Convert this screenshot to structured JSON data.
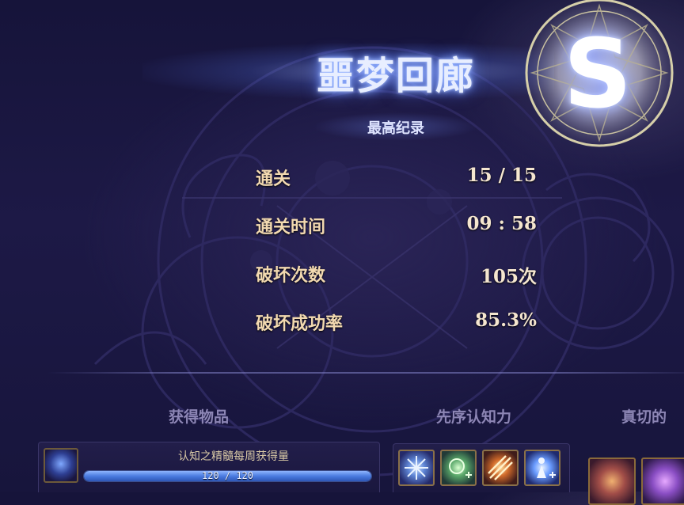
{
  "dungeon": {
    "title": "噩梦回廊",
    "rank": "S",
    "record_label": "最高纪录"
  },
  "stats": [
    {
      "label": "通关",
      "value": "15 / 15"
    },
    {
      "label": "通关时间",
      "value": "09 : 58"
    },
    {
      "label": "破坏次数",
      "value": "105次"
    },
    {
      "label": "破坏成功率",
      "value": "85.3%"
    }
  ],
  "sections": {
    "obtained_items": "获得物品",
    "cognition": "先序认知力",
    "true_reward": "真切的"
  },
  "weekly_progress": {
    "label": "认知之精髓每周获得量",
    "text": "120 / 120",
    "current": 120,
    "max": 120
  },
  "icons": {
    "item": "essence-orb-icon",
    "skills": [
      "frost-burst-icon",
      "green-rune-icon",
      "flame-slash-icon",
      "holy-figure-icon"
    ],
    "rewards": [
      "orange-reward-icon",
      "purple-reward-icon"
    ]
  },
  "colors": {
    "title_glow": "#8fb0ff",
    "stat_label": "#f2d9b0",
    "section_title": "#8d86b5",
    "progress_fill": "#4a7be0"
  }
}
